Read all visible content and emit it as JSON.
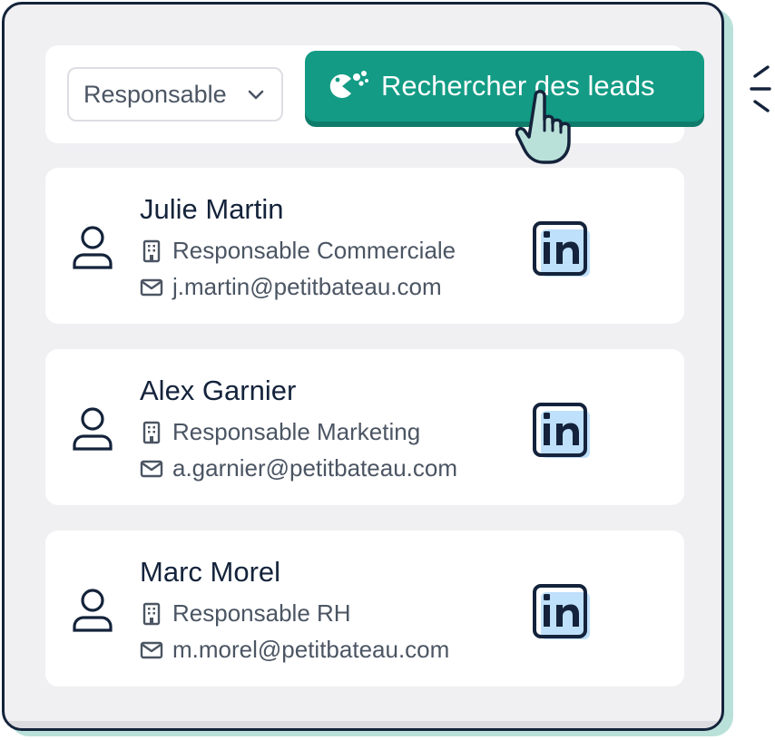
{
  "filter": {
    "selected": "Responsable",
    "icon": "chevron-down-icon"
  },
  "search_button": {
    "label": "Rechercher des leads",
    "icon": "pacman-dots-icon"
  },
  "colors": {
    "accent": "#139b85",
    "navy": "#14233b",
    "linkedin_fill": "#bfe0fb"
  },
  "leads": [
    {
      "name": "Julie Martin",
      "title": "Responsable Commerciale",
      "email": "j.martin@petitbateau.com"
    },
    {
      "name": "Alex Garnier",
      "title": "Responsable Marketing",
      "email": "a.garnier@petitbateau.com"
    },
    {
      "name": "Marc Morel",
      "title": "Responsable RH",
      "email": "m.morel@petitbateau.com"
    }
  ]
}
